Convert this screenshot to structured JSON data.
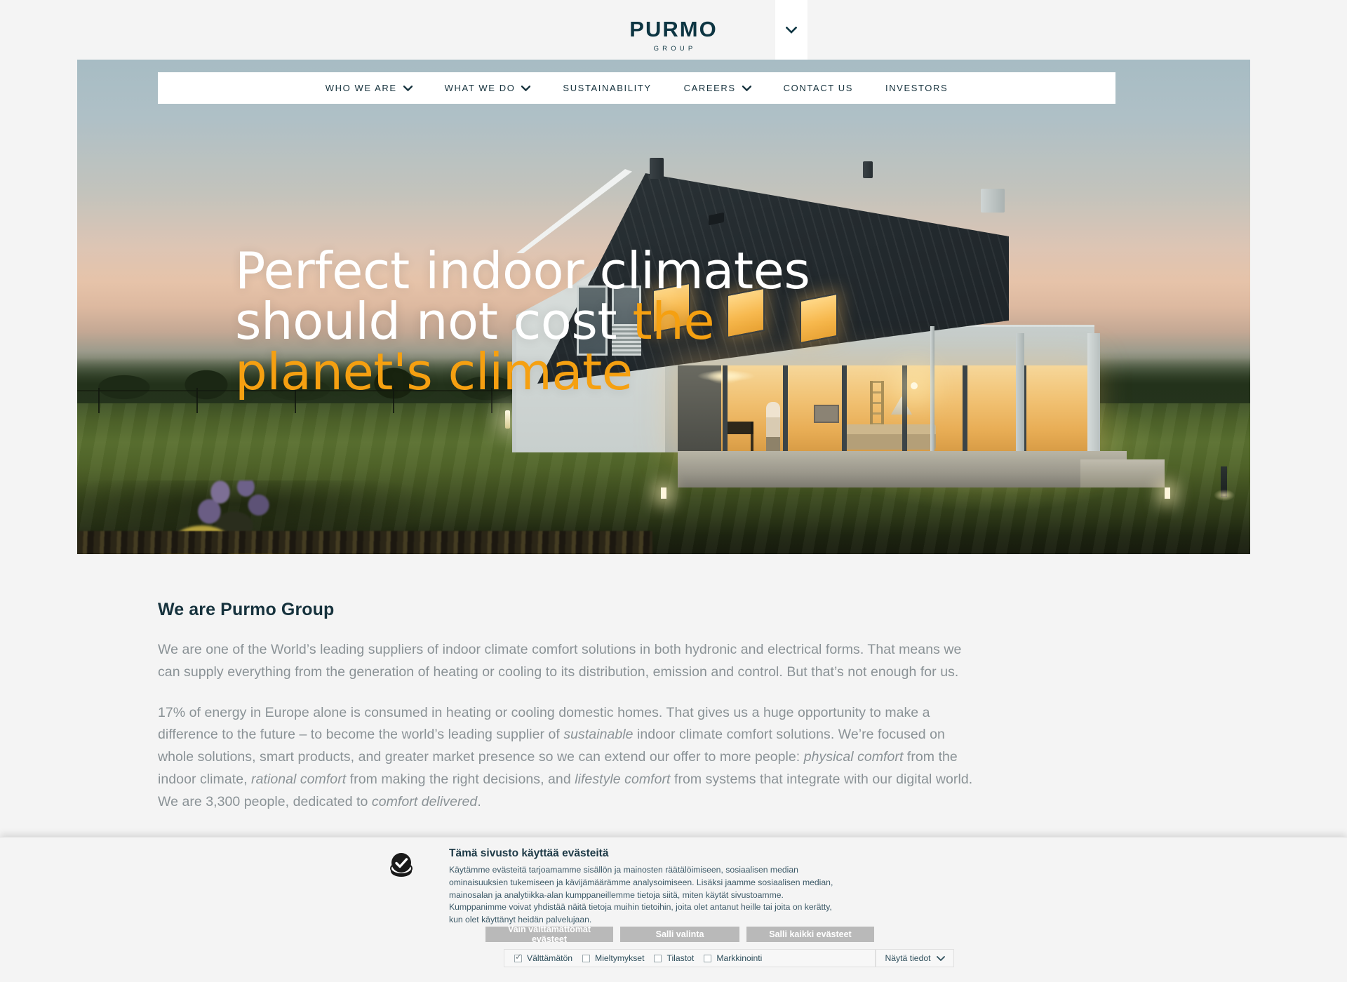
{
  "header": {
    "logo_main": "PURMO",
    "logo_sub": "GROUP",
    "lang_toggle_icon": "chevron-down-icon"
  },
  "nav": {
    "items": [
      {
        "label": "WHO WE ARE",
        "has_dropdown": true
      },
      {
        "label": "WHAT WE DO",
        "has_dropdown": true
      },
      {
        "label": "SUSTAINABILITY",
        "has_dropdown": false
      },
      {
        "label": "CAREERS",
        "has_dropdown": true
      },
      {
        "label": "CONTACT US",
        "has_dropdown": false
      },
      {
        "label": "INVESTORS",
        "has_dropdown": false
      }
    ]
  },
  "hero": {
    "headline_line1": "Perfect indoor climates",
    "headline_line2_white": "should not cost ",
    "headline_line2_accent": "the",
    "headline_line3_accent": "planet's climate",
    "accent_color": "#f5a011",
    "alt": "Modern house at dusk with illuminated interior and lawn"
  },
  "main": {
    "heading": "We are Purmo Group",
    "paragraph1": "We are one of the World’s leading suppliers of indoor climate comfort solutions in both hydronic and electrical forms. That means we can supply everything from the generation of heating or cooling to its distribution, emission and control. But that’s not enough for us.",
    "paragraph2": {
      "part1": "17% of energy in Europe alone is consumed in heating or cooling domestic homes. That gives us a huge opportunity to make a difference to the future – to become the world’s leading supplier of ",
      "em1": "sustainable",
      "part2": " indoor climate comfort solutions. We’re focused on whole solutions, smart products, and greater market presence so we can extend our offer to more people: ",
      "em2": "physical comfort",
      "part3": " from the indoor climate, ",
      "em3": "rational comfort",
      "part4": " from making the right decisions, and ",
      "em4": "lifestyle comfort",
      "part5": " from systems that integrate with our digital world. We are 3,300 people, dedicated to ",
      "em5": "comfort delivered",
      "part6": "."
    }
  },
  "cookie_banner": {
    "icon": "cookie-check-icon",
    "title": "Tämä sivusto käyttää evästeitä",
    "body": "Käytämme evästeitä tarjoamamme sisällön ja mainosten räätälöimiseen, sosiaalisen median ominaisuuksien tukemiseen ja kävijämäärämme analysoimiseen. Lisäksi jaamme sosiaalisen median, mainosalan ja analytiikka-alan kumppaneillemme tietoja siitä, miten käytät sivustoamme. Kumppanimme voivat yhdistää näitä tietoja muihin tietoihin, joita olet antanut heille tai joita on kerätty, kun olet käyttänyt heidän palvelujaan.",
    "buttons": [
      {
        "label": "Vain välttämättömät evästeet"
      },
      {
        "label": "Salli valinta"
      },
      {
        "label": "Salli kaikki evästeet"
      }
    ],
    "categories": [
      {
        "label": "Välttämätön",
        "checked": true
      },
      {
        "label": "Mieltymykset",
        "checked": false
      },
      {
        "label": "Tilastot",
        "checked": false
      },
      {
        "label": "Markkinointi",
        "checked": false
      }
    ],
    "details_label": "Näytä tiedot",
    "details_icon": "chevron-down-icon"
  }
}
